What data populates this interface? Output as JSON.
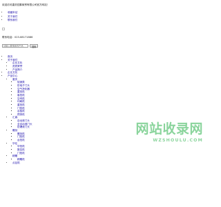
{
  "header": {
    "welcome": "欢迎访问重庆宏鹏商贸有限公司官方网站！",
    "links": [
      "收藏本站",
      "关于我们",
      "联系我们"
    ],
    "hotline": "联系电话：023-68171886"
  },
  "search": {
    "placeholder": "请输入要搜索的产品",
    "button": "搜索"
  },
  "nav": {
    "home": "首页",
    "about": "关于我们",
    "about_children": [
      "企业文化",
      "资质荣誉",
      "产品简介"
    ],
    "culture": "企业文化",
    "products": "产品中心",
    "group1": {
      "title": "重庆",
      "items": [
        "促销类",
        "防电子门头",
        "空气净化器",
        "重拍机",
        "客拍机",
        "空坞机",
        "印刷机",
        "重拍机",
        "门拍机",
        "台板机",
        "预排机"
      ]
    },
    "group2": {
      "title": "汇森",
      "items": [
        "自动滚门头",
        "全自动滚门头",
        "防爆滚门头"
      ]
    },
    "group3": {
      "title": "雕刻",
      "items": [
        "雕刻机",
        "门拍机",
        "台拍机"
      ]
    },
    "group4": {
      "title": "华伦",
      "items": [
        "华拍机",
        "数控机",
        "门拍机"
      ]
    },
    "group5": {
      "title": "精雕",
      "items": [
        "精雕机"
      ]
    },
    "last": "点钻机"
  },
  "watermark": {
    "main": "网站收录网",
    "sub": "WZSHOULU.COM"
  },
  "colors": {
    "link": "#1a0dab",
    "watermark": "#2bb24c"
  }
}
